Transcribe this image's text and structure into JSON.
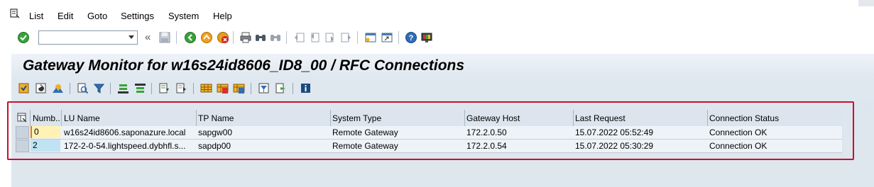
{
  "menu": {
    "items": [
      "List",
      "Edit",
      "Goto",
      "Settings",
      "System",
      "Help"
    ]
  },
  "toolbar": {
    "command_value": "",
    "back_glyph": "«"
  },
  "title": "Gateway Monitor for w16s24id8606_ID8_00 / RFC Connections",
  "table": {
    "columns": [
      "Numb...",
      "LU Name",
      "TP Name",
      "System Type",
      "Gateway Host",
      "Last Request",
      "Connection Status"
    ],
    "rows": [
      [
        "0",
        "w16s24id8606.saponazure.local",
        "sapgw00",
        "Remote Gateway",
        "172.2.0.50",
        "15.07.2022 05:52:49",
        "Connection OK"
      ],
      [
        "2",
        "172-2-0-54.lightspeed.dybhfl.s...",
        "sapdp00",
        "Remote Gateway",
        "172.2.0.54",
        "15.07.2022 05:30:29",
        "Connection OK"
      ]
    ]
  },
  "colors": {
    "highlight_border": "#c8102e",
    "number_cell_row1": "#fff2b3",
    "number_cell_row2": "#bfe3f2"
  }
}
